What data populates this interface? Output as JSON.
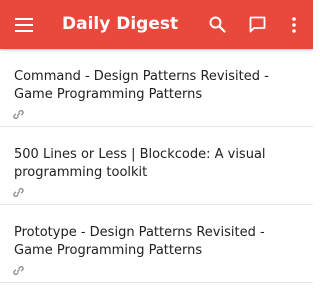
{
  "toolbar": {
    "title": "Daily Digest",
    "bg_color": "#e8493c",
    "icons": {
      "menu": "hamburger-menu-icon",
      "search": "search-icon",
      "chat": "chat-bubble-icon",
      "more": "more-vert-icon"
    }
  },
  "articles": [
    {
      "title": "Command - Design Patterns Revisited - Game Programming Patterns",
      "icon": "link-icon"
    },
    {
      "title": "500 Lines or Less | Blockcode: A visual programming toolkit",
      "icon": "link-icon"
    },
    {
      "title": "Prototype - Design Patterns Revisited - Game Programming Patterns",
      "icon": "link-icon"
    }
  ]
}
